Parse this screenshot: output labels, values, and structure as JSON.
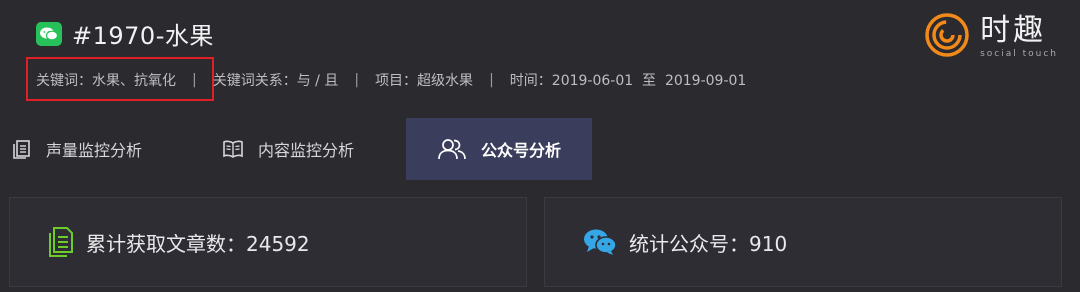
{
  "header": {
    "title": "#1970-水果",
    "keywords": "关键词：水果、抗氧化",
    "relation": "关键词关系：与 / 且",
    "project": "项目：超级水果",
    "time": "时间：2019-06-01  至  2019-09-01",
    "separator": "|"
  },
  "logo": {
    "name_cn": "时趣",
    "name_en": "social touch"
  },
  "tabs": [
    {
      "label": "声量监控分析",
      "icon": "document-list-icon",
      "active": false
    },
    {
      "label": "内容监控分析",
      "icon": "open-book-icon",
      "active": false
    },
    {
      "label": "公众号分析",
      "icon": "people-icon",
      "active": true
    }
  ],
  "cards": [
    {
      "label": "累计获取文章数：24592",
      "icon": "article-icon",
      "icon_color": "#6ccc2a"
    },
    {
      "label": "统计公众号：910",
      "icon": "wechat-icon",
      "icon_color": "#36a7e6"
    }
  ],
  "colors": {
    "background": "#2a2a2f",
    "active_tab": "#3a3d5b",
    "highlight_box": "#e01f26",
    "logo_orange": "#f28a1a",
    "wechat_green": "#27c15a"
  }
}
